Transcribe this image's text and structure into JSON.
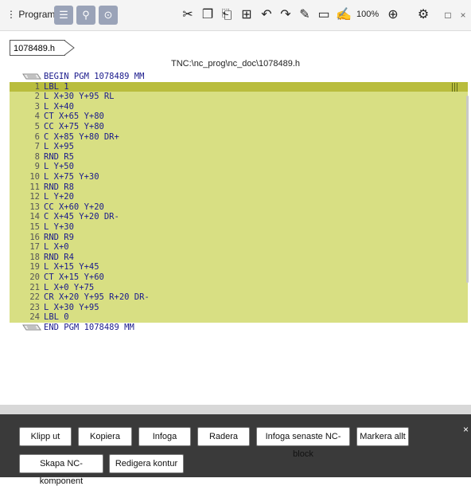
{
  "toolbar": {
    "program_label": "Program",
    "zoom": "100%"
  },
  "tab": {
    "label": "1078489.h"
  },
  "path": "TNC:\\nc_prog\\nc_doc\\1078489.h",
  "lines": [
    {
      "num": "",
      "code": "BEGIN PGM 1078489 MM"
    },
    {
      "num": "1",
      "code": "LBL 1"
    },
    {
      "num": "2",
      "code": "L X+30 Y+95 RL"
    },
    {
      "num": "3",
      "code": "L X+40"
    },
    {
      "num": "4",
      "code": "CT X+65 Y+80"
    },
    {
      "num": "5",
      "code": "CC X+75 Y+80"
    },
    {
      "num": "6",
      "code": "C X+85 Y+80 DR+"
    },
    {
      "num": "7",
      "code": "L X+95"
    },
    {
      "num": "8",
      "code": "RND R5"
    },
    {
      "num": "9",
      "code": "L Y+50"
    },
    {
      "num": "10",
      "code": "L X+75 Y+30"
    },
    {
      "num": "11",
      "code": "RND R8"
    },
    {
      "num": "12",
      "code": "L Y+20"
    },
    {
      "num": "13",
      "code": "CC X+60 Y+20"
    },
    {
      "num": "14",
      "code": "C X+45 Y+20 DR-"
    },
    {
      "num": "15",
      "code": "L Y+30"
    },
    {
      "num": "16",
      "code": "RND R9"
    },
    {
      "num": "17",
      "code": "L X+0"
    },
    {
      "num": "18",
      "code": "RND R4"
    },
    {
      "num": "19",
      "code": "L X+15 Y+45"
    },
    {
      "num": "20",
      "code": "CT X+15 Y+60"
    },
    {
      "num": "21",
      "code": "L X+0 Y+75"
    },
    {
      "num": "22",
      "code": "CR X+20 Y+95 R+20 DR-"
    },
    {
      "num": "23",
      "code": "L X+30 Y+95"
    },
    {
      "num": "24",
      "code": "LBL 0"
    },
    {
      "num": "",
      "code": "END PGM 1078489 MM"
    }
  ],
  "buttons": {
    "cut": "Klipp ut",
    "copy": "Kopiera",
    "paste": "Infoga",
    "delete": "Radera",
    "insert_last": "Infoga senaste NC-block",
    "select_all": "Markera allt",
    "create_component": "Skapa NC-komponent",
    "edit_contour": "Redigera kontur"
  },
  "colors": {
    "highlight": "#d8df83",
    "current_line": "#b9bd3d",
    "code_text": "#1a1a8c"
  }
}
